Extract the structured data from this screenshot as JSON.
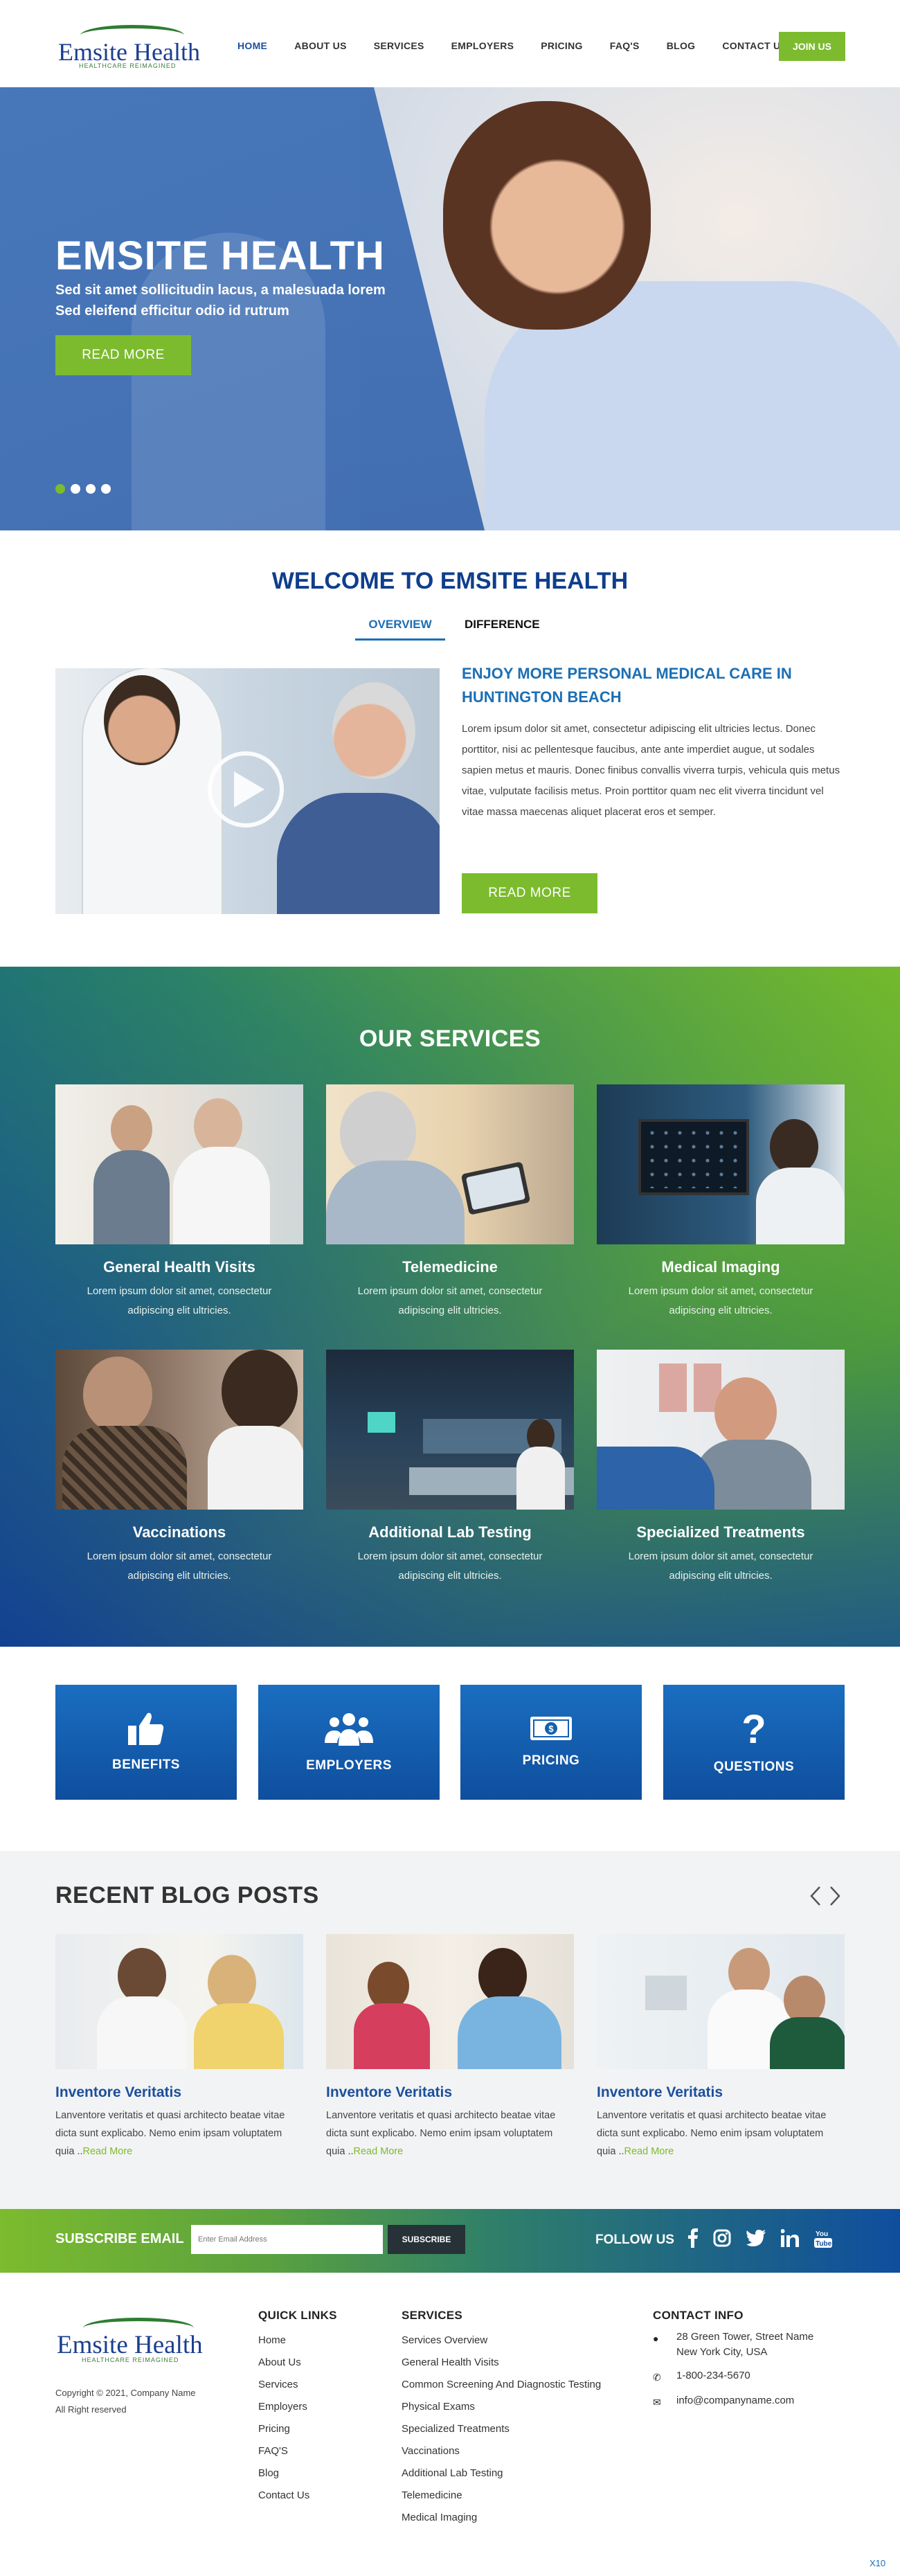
{
  "brand": {
    "name": "Emsite Health",
    "tagline": "HEALTHCARE REIMAGINED"
  },
  "nav": {
    "items": [
      "HOME",
      "ABOUT US",
      "SERVICES",
      "EMPLOYERS",
      "PRICING",
      "FAQ'S",
      "BLOG",
      "CONTACT US"
    ],
    "join": "JOIN US"
  },
  "hero": {
    "title": "EMSITE HEALTH",
    "line1": "Sed sit amet sollicitudin lacus, a malesuada lorem",
    "line2": "Sed eleifend efficitur odio id rutrum",
    "button": "READ MORE",
    "slides": 4,
    "active_slide": 1
  },
  "welcome": {
    "title": "WELCOME TO EMSITE HEALTH",
    "tabs": [
      "OVERVIEW",
      "DIFFERENCE"
    ],
    "heading": "ENJOY MORE PERSONAL MEDICAL CARE IN HUNTINGTON BEACH",
    "body": "Lorem ipsum dolor sit amet, consectetur adipiscing elit ultricies lectus. Donec porttitor, nisi ac pellentesque faucibus, ante ante imperdiet augue, ut sodales sapien metus et mauris. Donec finibus convallis viverra turpis, vehicula quis metus vitae, vulputate facilisis metus. Proin porttitor quam nec elit viverra tincidunt vel vitae massa maecenas aliquet placerat eros et semper.",
    "button": "READ MORE"
  },
  "services": {
    "title": "OUR SERVICES",
    "items": [
      {
        "title": "General Health Visits",
        "text": "Lorem ipsum dolor sit amet, consectetur adipiscing elit ultricies."
      },
      {
        "title": "Telemedicine",
        "text": "Lorem ipsum dolor sit amet, consectetur adipiscing elit ultricies."
      },
      {
        "title": "Medical Imaging",
        "text": "Lorem ipsum dolor sit amet, consectetur adipiscing elit ultricies."
      },
      {
        "title": "Vaccinations",
        "text": "Lorem ipsum dolor sit amet, consectetur adipiscing elit ultricies."
      },
      {
        "title": "Additional Lab Testing",
        "text": "Lorem ipsum dolor sit amet, consectetur adipiscing elit ultricies."
      },
      {
        "title": "Specialized Treatments",
        "text": "Lorem ipsum dolor sit amet, consectetur adipiscing elit ultricies."
      }
    ]
  },
  "features": [
    {
      "label": "BENEFITS",
      "icon": "thumbs-up-icon"
    },
    {
      "label": "EMPLOYERS",
      "icon": "group-icon"
    },
    {
      "label": "PRICING",
      "icon": "money-icon"
    },
    {
      "label": "QUESTIONS",
      "icon": "question-icon"
    }
  ],
  "blog": {
    "title": "RECENT BLOG POSTS",
    "posts": [
      {
        "title": "Inventore Veritatis",
        "text": "Lanventore veritatis et quasi architecto beatae vitae dicta sunt explicabo. Nemo enim ipsam voluptatem quia ..",
        "more": "Read More"
      },
      {
        "title": "Inventore Veritatis",
        "text": "Lanventore veritatis et quasi architecto beatae vitae dicta sunt explicabo. Nemo enim ipsam voluptatem quia ..",
        "more": "Read More"
      },
      {
        "title": "Inventore Veritatis",
        "text": "Lanventore veritatis et quasi architecto beatae vitae dicta sunt explicabo. Nemo enim ipsam voluptatem quia ..",
        "more": "Read More"
      }
    ]
  },
  "subscribe": {
    "label": "SUBSCRIBE EMAIL",
    "placeholder": "Enter Email Address",
    "button": "SUBSCRIBE",
    "follow": "FOLLOW US"
  },
  "footer": {
    "copyright1": "Copyright © 2021, Company Name",
    "copyright2": "All Right reserved",
    "quick_links_title": "QUICK LINKS",
    "quick_links": [
      "Home",
      "About Us",
      "Services",
      "Employers",
      "Pricing",
      "FAQ'S",
      "Blog",
      "Contact Us"
    ],
    "services_title": "SERVICES",
    "services": [
      "Services Overview",
      "General Health Visits",
      "Common Screening And Diagnostic Testing",
      "Physical Exams",
      "Specialized Treatments",
      "Vaccinations",
      "Additional Lab Testing",
      "Telemedicine",
      "Medical Imaging"
    ],
    "contact_title": "CONTACT INFO",
    "address1": "28 Green Tower, Street Name",
    "address2": "New York City, USA",
    "phone": "1-800-234-5670",
    "email": "info@companyname.com"
  },
  "corner_label": "X10",
  "colors": {
    "primary": "#1b4f9c",
    "accent": "#7cbb2e",
    "heading": "#0f3e8c"
  }
}
